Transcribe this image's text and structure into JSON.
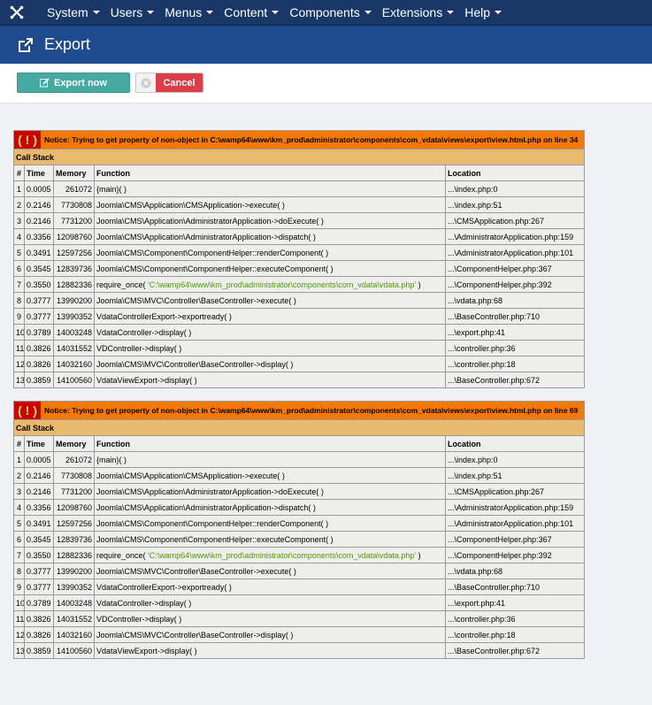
{
  "navbar": {
    "logo_icon": "joomla-logo-icon",
    "menus": [
      "System",
      "Users",
      "Menus",
      "Content",
      "Components",
      "Extensions",
      "Help"
    ]
  },
  "title": {
    "icon": "export-icon",
    "text": "Export"
  },
  "toolbar": {
    "export_label": "Export now",
    "cancel_label": "Cancel"
  },
  "notices": [
    {
      "bang": "( ! )",
      "message": "Notice: Trying to get property of non-object in C:\\wamp64\\www\\km_prod\\administrator\\components\\com_vdata\\views\\export\\view.html.php on line 34",
      "call_stack_label": "Call Stack",
      "headers": [
        "#",
        "Time",
        "Memory",
        "Function",
        "Location"
      ],
      "rows": [
        {
          "n": "1",
          "time": "0.0005",
          "mem": "261072",
          "fn": "{main}( )",
          "loc": "...\\index.php:0"
        },
        {
          "n": "2",
          "time": "0.2146",
          "mem": "7730808",
          "fn": "Joomla\\CMS\\Application\\CMSApplication->execute( )",
          "loc": "...\\index.php:51"
        },
        {
          "n": "3",
          "time": "0.2146",
          "mem": "7731200",
          "fn": "Joomla\\CMS\\Application\\AdministratorApplication->doExecute( )",
          "loc": "...\\CMSApplication.php:267"
        },
        {
          "n": "4",
          "time": "0.3356",
          "mem": "12098760",
          "fn": "Joomla\\CMS\\Application\\AdministratorApplication->dispatch( )",
          "loc": "...\\AdministratorApplication.php:159"
        },
        {
          "n": "5",
          "time": "0.3491",
          "mem": "12597256",
          "fn": "Joomla\\CMS\\Component\\ComponentHelper::renderComponent( )",
          "loc": "...\\AdministratorApplication.php:101"
        },
        {
          "n": "6",
          "time": "0.3545",
          "mem": "12839736",
          "fn": "Joomla\\CMS\\Component\\ComponentHelper::executeComponent( )",
          "loc": "...\\ComponentHelper.php:367"
        },
        {
          "n": "7",
          "time": "0.3550",
          "mem": "12882336",
          "fn": "require_once( ",
          "fn_path": "'C:\\wamp64\\www\\km_prod\\administrator\\components\\com_vdata\\vdata.php'",
          "fn_end": " )",
          "loc": "...\\ComponentHelper.php:392"
        },
        {
          "n": "8",
          "time": "0.3777",
          "mem": "13990200",
          "fn": "Joomla\\CMS\\MVC\\Controller\\BaseController->execute( )",
          "loc": "...\\vdata.php:68"
        },
        {
          "n": "9",
          "time": "0.3777",
          "mem": "13990352",
          "fn": "VdataControllerExport->exportready( )",
          "loc": "...\\BaseController.php:710"
        },
        {
          "n": "10",
          "time": "0.3789",
          "mem": "14003248",
          "fn": "VdataController->display( )",
          "loc": "...\\export.php:41"
        },
        {
          "n": "11",
          "time": "0.3826",
          "mem": "14031552",
          "fn": "VDController->display( )",
          "loc": "...\\controller.php:36"
        },
        {
          "n": "12",
          "time": "0.3826",
          "mem": "14032160",
          "fn": "Joomla\\CMS\\MVC\\Controller\\BaseController->display( )",
          "loc": "...\\controller.php:18"
        },
        {
          "n": "13",
          "time": "0.3859",
          "mem": "14100560",
          "fn": "VdataViewExport->display( )",
          "loc": "...\\BaseController.php:672"
        }
      ]
    },
    {
      "bang": "( ! )",
      "message": "Notice: Trying to get property of non-object in C:\\wamp64\\www\\km_prod\\administrator\\components\\com_vdata\\views\\export\\view.html.php on line 69",
      "call_stack_label": "Call Stack",
      "headers": [
        "#",
        "Time",
        "Memory",
        "Function",
        "Location"
      ],
      "rows": [
        {
          "n": "1",
          "time": "0.0005",
          "mem": "261072",
          "fn": "{main}( )",
          "loc": "...\\index.php:0"
        },
        {
          "n": "2",
          "time": "0.2146",
          "mem": "7730808",
          "fn": "Joomla\\CMS\\Application\\CMSApplication->execute( )",
          "loc": "...\\index.php:51"
        },
        {
          "n": "3",
          "time": "0.2146",
          "mem": "7731200",
          "fn": "Joomla\\CMS\\Application\\AdministratorApplication->doExecute( )",
          "loc": "...\\CMSApplication.php:267"
        },
        {
          "n": "4",
          "time": "0.3356",
          "mem": "12098760",
          "fn": "Joomla\\CMS\\Application\\AdministratorApplication->dispatch( )",
          "loc": "...\\AdministratorApplication.php:159"
        },
        {
          "n": "5",
          "time": "0.3491",
          "mem": "12597256",
          "fn": "Joomla\\CMS\\Component\\ComponentHelper::renderComponent( )",
          "loc": "...\\AdministratorApplication.php:101"
        },
        {
          "n": "6",
          "time": "0.3545",
          "mem": "12839736",
          "fn": "Joomla\\CMS\\Component\\ComponentHelper::executeComponent( )",
          "loc": "...\\ComponentHelper.php:367"
        },
        {
          "n": "7",
          "time": "0.3550",
          "mem": "12882336",
          "fn": "require_once( ",
          "fn_path": "'C:\\wamp64\\www\\km_prod\\administrator\\components\\com_vdata\\vdata.php'",
          "fn_end": " )",
          "loc": "...\\ComponentHelper.php:392"
        },
        {
          "n": "8",
          "time": "0.3777",
          "mem": "13990200",
          "fn": "Joomla\\CMS\\MVC\\Controller\\BaseController->execute( )",
          "loc": "...\\vdata.php:68"
        },
        {
          "n": "9",
          "time": "0.3777",
          "mem": "13990352",
          "fn": "VdataControllerExport->exportready( )",
          "loc": "...\\BaseController.php:710"
        },
        {
          "n": "10",
          "time": "0.3789",
          "mem": "14003248",
          "fn": "VdataController->display( )",
          "loc": "...\\export.php:41"
        },
        {
          "n": "11",
          "time": "0.3826",
          "mem": "14031552",
          "fn": "VDController->display( )",
          "loc": "...\\controller.php:36"
        },
        {
          "n": "12",
          "time": "0.3826",
          "mem": "14032160",
          "fn": "Joomla\\CMS\\MVC\\Controller\\BaseController->display( )",
          "loc": "...\\controller.php:18"
        },
        {
          "n": "13",
          "time": "0.3859",
          "mem": "14100560",
          "fn": "VdataViewExport->display( )",
          "loc": "...\\BaseController.php:672"
        }
      ]
    }
  ],
  "colors": {
    "navbar": "#1a3867",
    "titlebar": "#1f4b8e",
    "export_button": "#46a9a2",
    "cancel_button": "#db3e48",
    "notice_bar": "#f57900",
    "call_stack_bar": "#e9b96e",
    "bang_bg": "#cc0000"
  }
}
